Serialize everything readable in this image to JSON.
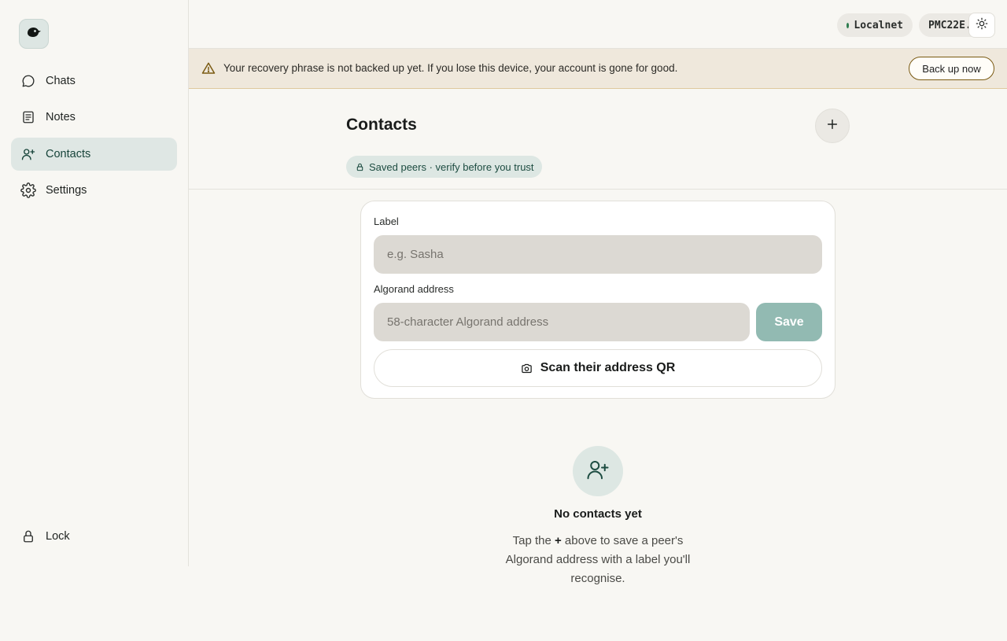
{
  "sidebar": {
    "items": [
      {
        "label": "Chats",
        "icon": "chat-bubble-icon"
      },
      {
        "label": "Notes",
        "icon": "note-icon"
      },
      {
        "label": "Contacts",
        "icon": "user-plus-icon",
        "active": true
      },
      {
        "label": "Settings",
        "icon": "gear-icon"
      }
    ],
    "lock_label": "Lock"
  },
  "header": {
    "network": "Localnet",
    "account": "PMC22E..."
  },
  "banner": {
    "message": "Your recovery phrase is not backed up yet. If you lose this device, your account is gone for good.",
    "button": "Back up now"
  },
  "page": {
    "title": "Contacts",
    "badge": "Saved peers · verify before you trust"
  },
  "form": {
    "label_title": "Label",
    "label_placeholder": "e.g. Sasha",
    "address_title": "Algorand address",
    "address_placeholder": "58-character Algorand address",
    "save": "Save",
    "scan": "Scan their address QR"
  },
  "empty": {
    "title": "No contacts yet",
    "desc_before": "Tap the ",
    "desc_plus": "+",
    "desc_after": " above to save a peer's Algorand address with a label you'll recognise."
  },
  "colors": {
    "accent": "#17443a",
    "save_disabled": "#92bab2",
    "banner_bg": "#efe8dc",
    "status_dot": "#2e7d4f"
  }
}
